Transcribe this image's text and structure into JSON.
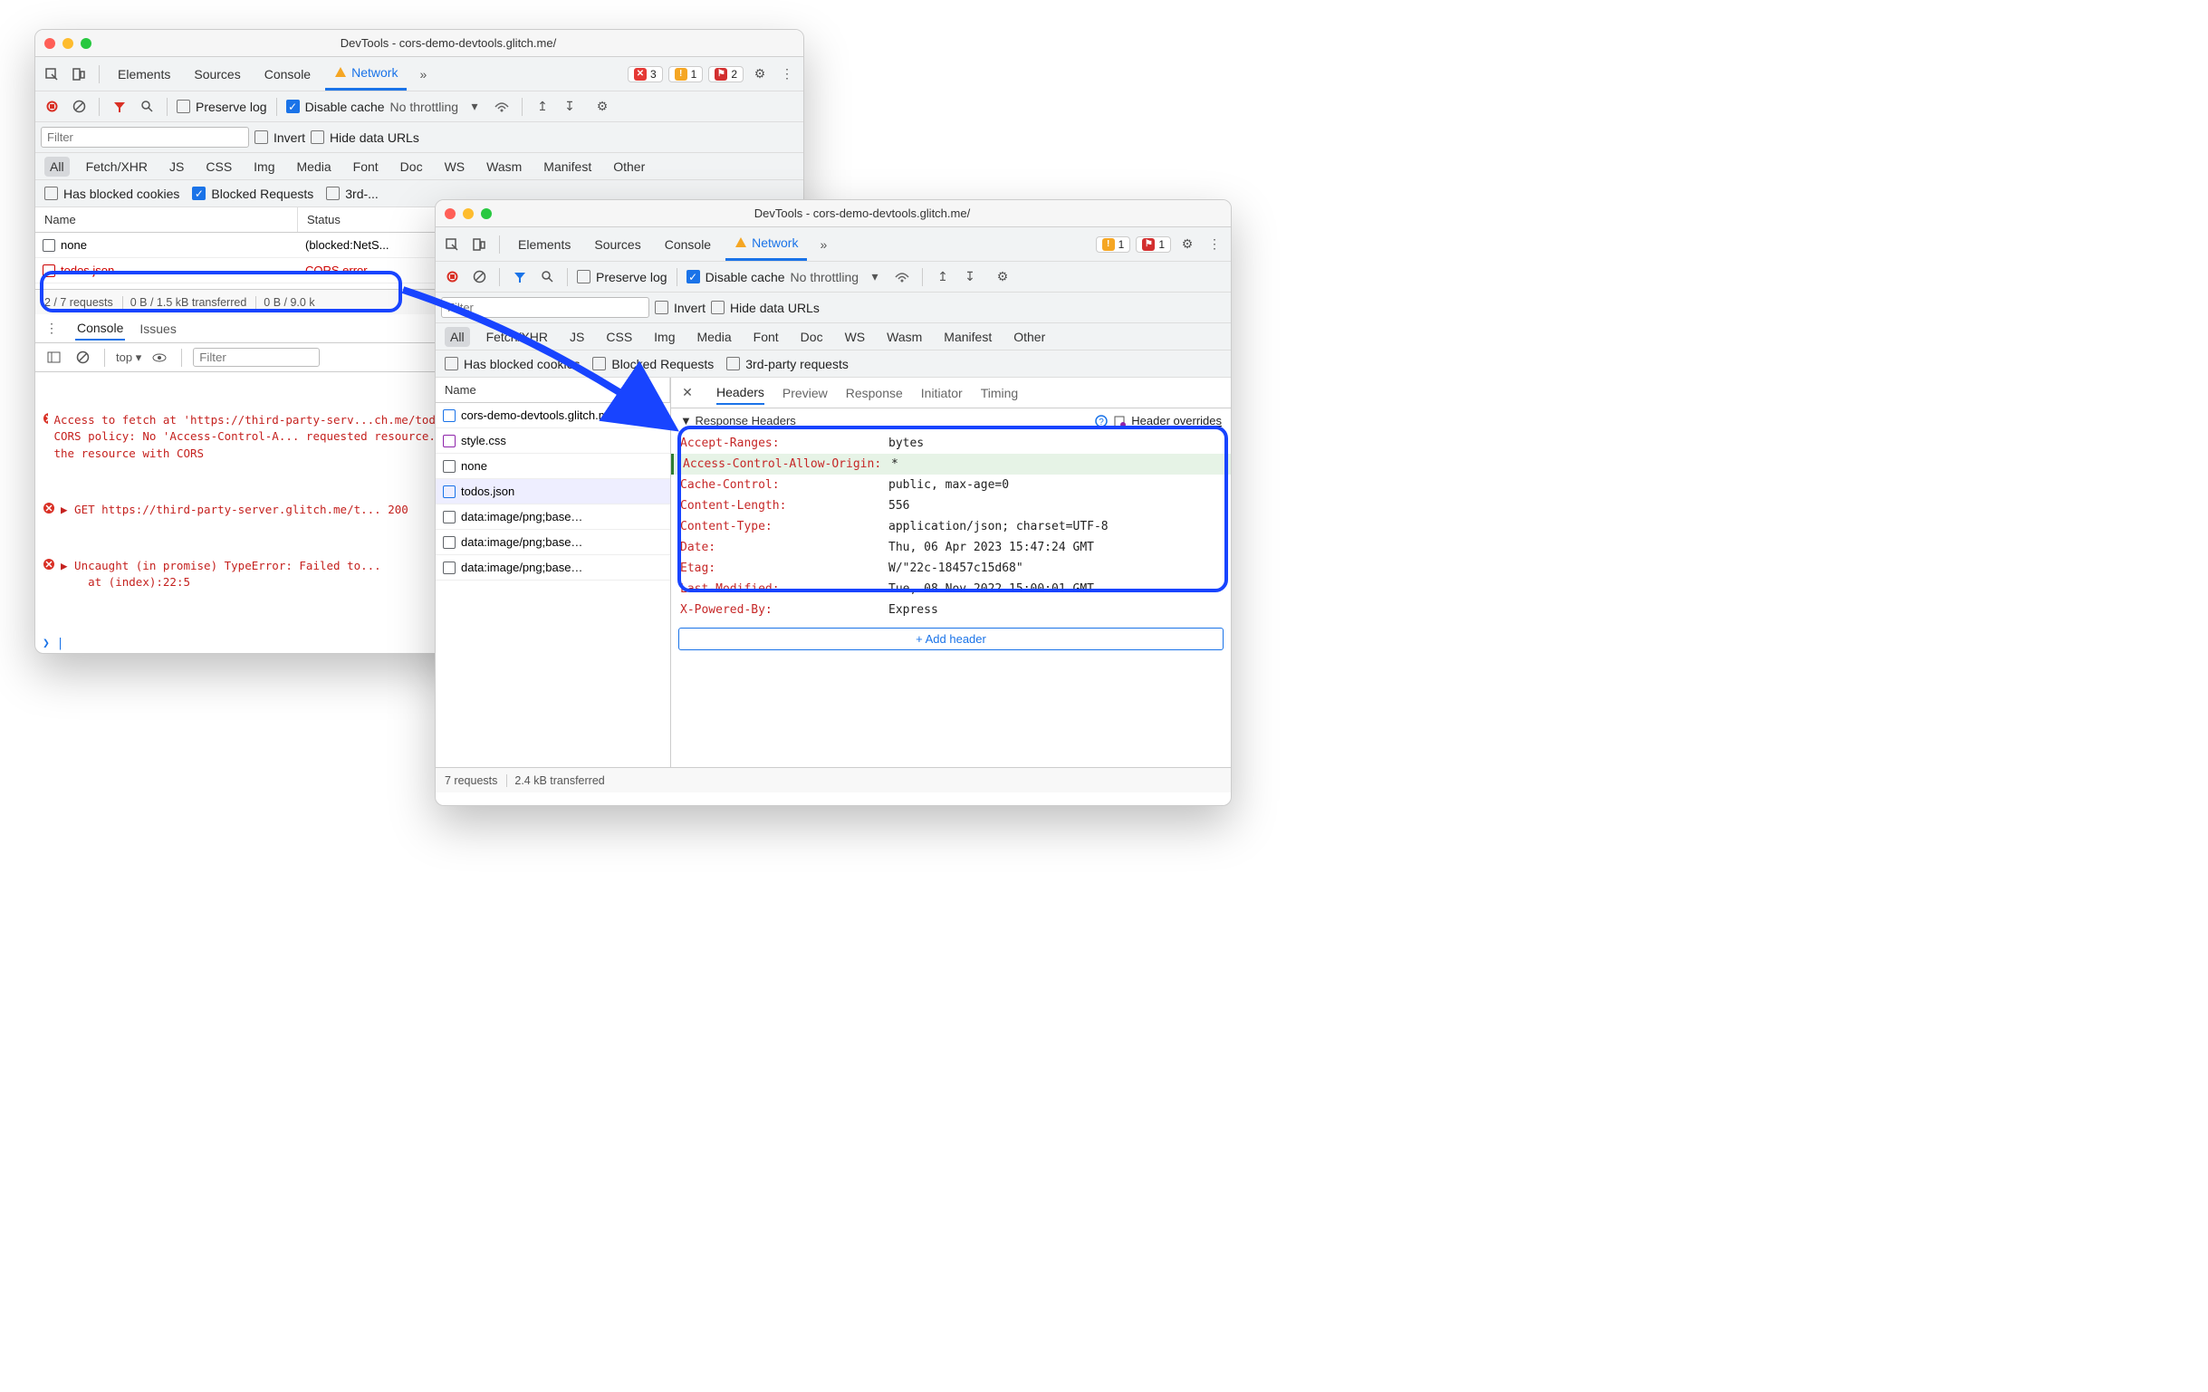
{
  "window_a": {
    "title": "DevTools - cors-demo-devtools.glitch.me/",
    "tabs": [
      "Elements",
      "Sources",
      "Console",
      "Network"
    ],
    "badges": {
      "err": "3",
      "warn": "1",
      "issue": "2"
    },
    "options": {
      "preserve_log": "Preserve log",
      "disable_cache": "Disable cache",
      "throttling": "No throttling"
    },
    "filter_placeholder": "Filter",
    "filter_opts": {
      "invert": "Invert",
      "hide_data": "Hide data URLs"
    },
    "type_filters": [
      "All",
      "Fetch/XHR",
      "JS",
      "CSS",
      "Img",
      "Media",
      "Font",
      "Doc",
      "WS",
      "Wasm",
      "Manifest",
      "Other"
    ],
    "extra_filters": {
      "blocked_cookies": "Has blocked cookies",
      "blocked_req": "Blocked Requests",
      "third": "3rd-..."
    },
    "columns": {
      "name": "Name",
      "status": "Status"
    },
    "rows": [
      {
        "name": "none",
        "status": "(blocked:NetS..."
      },
      {
        "name": "todos.json",
        "status": "CORS error",
        "err": true
      }
    ],
    "status": {
      "requests": "2 / 7 requests",
      "transferred": "0 B / 1.5 kB transferred",
      "resources": "0 B / 9.0 k"
    },
    "drawer": {
      "tabs": [
        "Console",
        "Issues"
      ],
      "context": "top",
      "filter_placeholder": "Filter",
      "msgs": [
        "Access to fetch at 'https://third-party-serv...ch.me/todos.json' from origin 'https://cors-... blocked by CORS policy: No 'Access-Control-A... requested resource. If an opaque response se... to 'no-cors' to fetch the resource with CORS",
        "▶ GET https://third-party-server.glitch.me/t... 200",
        "▶ Uncaught (in promise) TypeError: Failed to...\n    at (index):22:5"
      ]
    }
  },
  "window_b": {
    "title": "DevTools - cors-demo-devtools.glitch.me/",
    "tabs": [
      "Elements",
      "Sources",
      "Console",
      "Network"
    ],
    "badges": {
      "warn": "1",
      "issue": "1"
    },
    "options": {
      "preserve_log": "Preserve log",
      "disable_cache": "Disable cache",
      "throttling": "No throttling"
    },
    "filter_placeholder": "Filter",
    "filter_opts": {
      "invert": "Invert",
      "hide_data": "Hide data URLs"
    },
    "type_filters": [
      "All",
      "Fetch/XHR",
      "JS",
      "CSS",
      "Img",
      "Media",
      "Font",
      "Doc",
      "WS",
      "Wasm",
      "Manifest",
      "Other"
    ],
    "extra_filters": {
      "blocked_cookies": "Has blocked cookies",
      "blocked_req": "Blocked Requests",
      "third": "3rd-party requests"
    },
    "columns": {
      "name": "Name"
    },
    "netlist": [
      {
        "name": "cors-demo-devtools.glitch.me",
        "type": "doc"
      },
      {
        "name": "style.css",
        "type": "css"
      },
      {
        "name": "none",
        "type": "none"
      },
      {
        "name": "todos.json",
        "type": "doc",
        "selected": true
      },
      {
        "name": "data:image/png;base…",
        "type": "none"
      },
      {
        "name": "data:image/png;base…",
        "type": "none"
      },
      {
        "name": "data:image/png;base…",
        "type": "none"
      }
    ],
    "detail_tabs": [
      "Headers",
      "Preview",
      "Response",
      "Initiator",
      "Timing"
    ],
    "section": {
      "title": "Response Headers",
      "overrides": "Header overrides"
    },
    "headers": [
      {
        "k": "Accept-Ranges:",
        "v": "bytes"
      },
      {
        "k": "Access-Control-Allow-Origin:",
        "v": "*",
        "highlight": true
      },
      {
        "k": "Cache-Control:",
        "v": "public, max-age=0"
      },
      {
        "k": "Content-Length:",
        "v": "556"
      },
      {
        "k": "Content-Type:",
        "v": "application/json; charset=UTF-8"
      },
      {
        "k": "Date:",
        "v": "Thu, 06 Apr 2023 15:47:24 GMT"
      },
      {
        "k": "Etag:",
        "v": "W/\"22c-18457c15d68\""
      },
      {
        "k": "Last-Modified:",
        "v": "Tue, 08 Nov 2022 15:00:01 GMT"
      },
      {
        "k": "X-Powered-By:",
        "v": "Express"
      }
    ],
    "add_header": "+ Add header",
    "status": {
      "requests": "7 requests",
      "transferred": "2.4 kB transferred"
    }
  }
}
